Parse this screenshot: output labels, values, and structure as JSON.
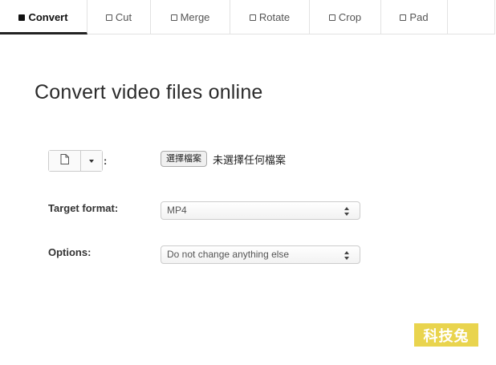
{
  "tabs": [
    {
      "label": "Convert",
      "active": true
    },
    {
      "label": "Cut",
      "active": false
    },
    {
      "label": "Merge",
      "active": false
    },
    {
      "label": "Rotate",
      "active": false
    },
    {
      "label": "Crop",
      "active": false
    },
    {
      "label": "Pad",
      "active": false
    }
  ],
  "main": {
    "title": "Convert video files online",
    "source": {
      "colon": ":",
      "file_button_label": "選擇檔案",
      "file_status": "未選擇任何檔案",
      "doc_icon": "document-icon",
      "dropdown_icon": "caret-down-icon"
    },
    "target_format": {
      "label": "Target format:",
      "selected": "MP4"
    },
    "options": {
      "label": "Options:",
      "selected": "Do not change anything else"
    }
  },
  "watermark": {
    "text": "科技兔",
    "color": "#e9d44e"
  }
}
